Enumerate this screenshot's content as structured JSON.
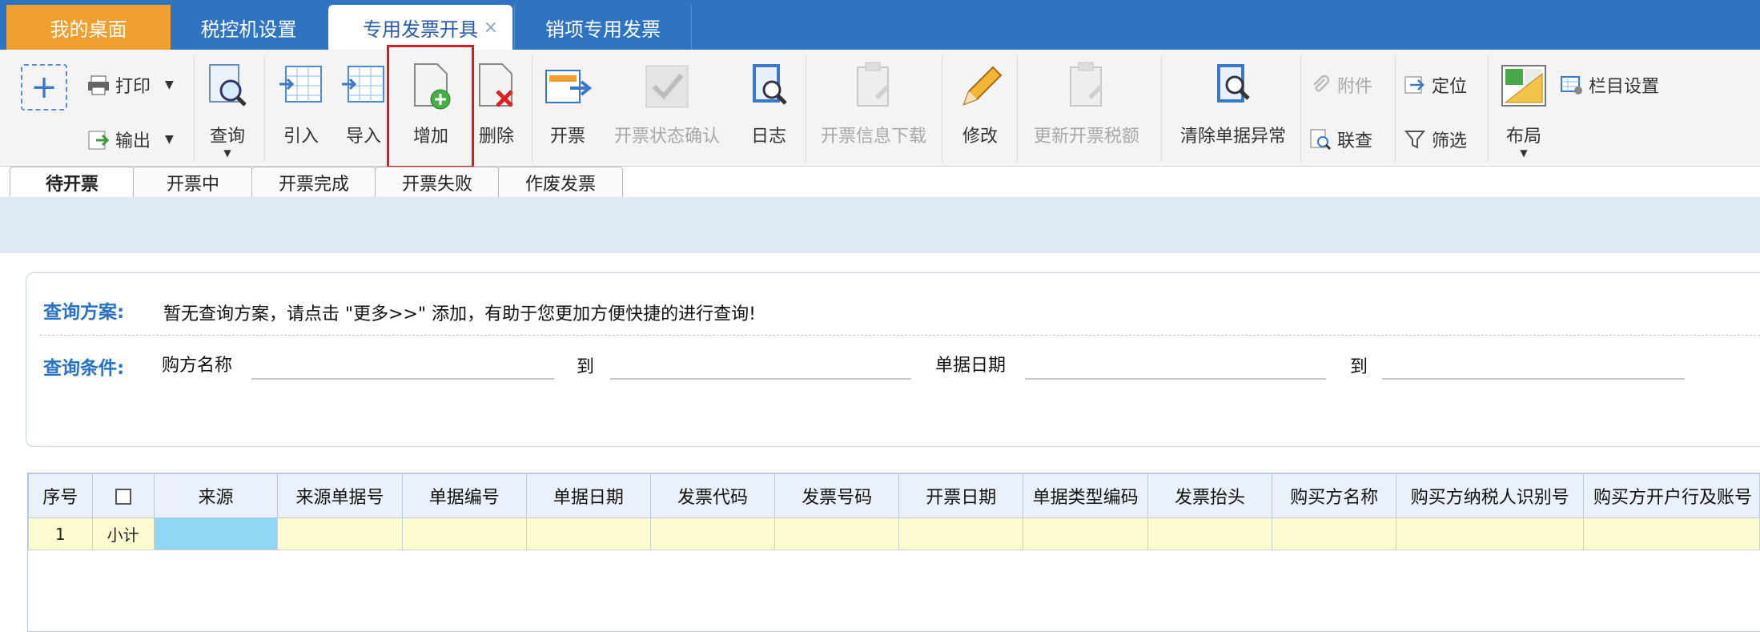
{
  "tabs": [
    {
      "label": "我的桌面"
    },
    {
      "label": "税控机设置"
    },
    {
      "label": "专用发票开具",
      "close": "×"
    },
    {
      "label": "销项专用发票"
    }
  ],
  "toolbar": {
    "add_new": "+",
    "print": "打印",
    "output": "输出",
    "query": "查询",
    "import_in": "引入",
    "import": "导入",
    "add": "增加",
    "delete": "删除",
    "issue": "开票",
    "issue_status_confirm": "开票状态确认",
    "log": "日志",
    "issue_info_download": "开票信息下载",
    "modify": "修改",
    "update_tax_amount": "更新开票税额",
    "clear_exception": "清除单据异常",
    "attachment": "附件",
    "link_query": "联查",
    "locate": "定位",
    "filter": "筛选",
    "layout": "布局",
    "column_settings": "栏目设置"
  },
  "subtabs": [
    {
      "label": "待开票",
      "active": true
    },
    {
      "label": "开票中"
    },
    {
      "label": "开票完成"
    },
    {
      "label": "开票失败"
    },
    {
      "label": "作废发票"
    }
  ],
  "query": {
    "scheme_label": "查询方案:",
    "scheme_text": "暂无查询方案，请点击 \"更多>>\" 添加，有助于您更加方便快捷的进行查询!",
    "condition_label": "查询条件:",
    "buyer_name": "购方名称",
    "to1": "到",
    "doc_date": "单据日期",
    "to2": "到"
  },
  "table": {
    "headers": [
      "序号",
      "",
      "来源",
      "来源单据号",
      "单据编号",
      "单据日期",
      "发票代码",
      "发票号码",
      "开票日期",
      "单据类型编码",
      "发票抬头",
      "购买方名称",
      "购买方纳税人识别号",
      "购买方开户行及账号"
    ],
    "row": {
      "index": "1",
      "subtotal": "小计"
    }
  },
  "colors": {
    "title_bar": "#2f74c0",
    "home_tab": "#f0a030",
    "highlight": "#e11b1b",
    "query_label": "#2a72c2"
  }
}
